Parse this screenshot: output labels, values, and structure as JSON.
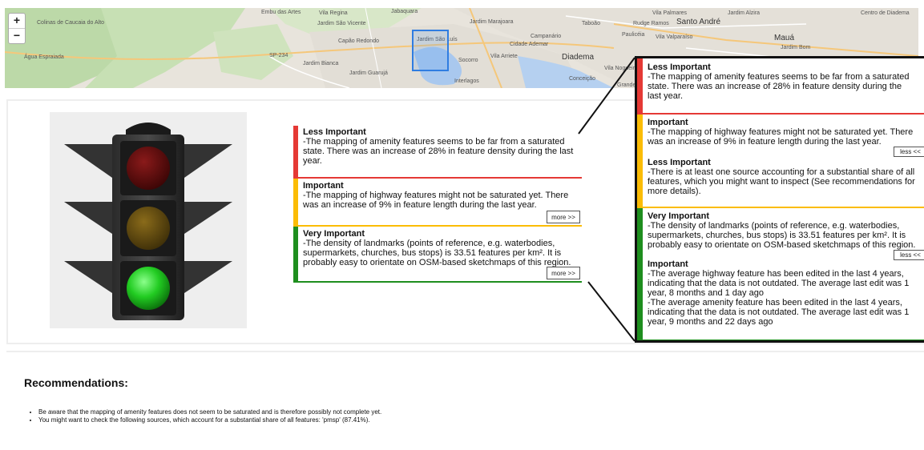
{
  "map": {
    "zoom_in": "+",
    "zoom_out": "−",
    "places": [
      "Embu das Artes",
      "Vila Regina",
      "Jardim São Vicente",
      "Jabaquara",
      "Jardim Marajoara",
      "Taboão",
      "Santo André",
      "Jardim Alzira",
      "Vila Palmares",
      "Centro de Diadema",
      "Colinas de Caucaia do Alto",
      "Cidade Ademar",
      "Diadema",
      "Campanário",
      "Jardim São Luís",
      "Socorro",
      "Vila Arriete",
      "Capão Redondo",
      "Interlagos",
      "Jardim Bianca",
      "Jardim Guarujá",
      "Conceição",
      "Vila Nogueira",
      "Mauá",
      "Jardim Bom",
      "Vila Valparaíso",
      "Paulicéia",
      "Rudge Ramos",
      "Água Espraiada",
      "Grande",
      "SP-234"
    ]
  },
  "summary": {
    "items": [
      {
        "level": "Less Important",
        "text": "-The mapping of amenity features seems to be far from a saturated state. There was an increase of 28% in feature density during the last year.",
        "color": "#e53935"
      },
      {
        "level": "Important",
        "text": "-The mapping of highway features might not be saturated yet. There was an increase of 9% in feature length during the last year.",
        "color": "#fbbc05",
        "button": "more >>"
      },
      {
        "level": "Very Important",
        "text": "-The density of landmarks (points of reference, e.g. waterbodies, supermarkets, churches, bus stops) is 33.51 features per km². It is probably easy to orientate on OSM-based sketchmaps of this region.",
        "color": "#1e8e1e",
        "button": "more >>"
      }
    ]
  },
  "popup": {
    "red": {
      "level": "Less Important",
      "text": "-The mapping of amenity features seems to be far from a saturated state. There was an increase of 28% in feature density during the last year.",
      "color": "#e53935"
    },
    "yellow": {
      "a_level": "Important",
      "a_text": "-The mapping of highway features might not be saturated yet. There was an increase of 9% in feature length during the last year.",
      "button": "less <<",
      "b_level": "Less Important",
      "b_text": "-There is at least one source accounting for a substantial share of all features, which you might want to inspect (See recommendations for more details).",
      "color": "#fbbc05"
    },
    "green": {
      "a_level": "Very Important",
      "a_text": "-The density of landmarks (points of reference, e.g. waterbodies, supermarkets, churches, bus stops) is 33.51 features per km². It is probably easy to orientate on OSM-based sketchmaps of this region.",
      "button": "less <<",
      "b_level": "Important",
      "b_text1": "-The average highway feature has been edited in the last 4 years, indicating that the data is not outdated. The average last edit was 1 year, 8 months and 1 day ago",
      "b_text2": "-The average amenity feature has been edited in the last 4 years, indicating that the data is not outdated. The average last edit was 1 year, 9 months and 22 days ago",
      "color": "#1e8e1e"
    }
  },
  "recommendations": {
    "title": "Recommendations:",
    "items": [
      "Be aware that the mapping of amenity features does not seem to be saturated and is therefore possibly not complete yet.",
      "You might want to check the following sources, which account for a substantial share of all features: 'pmsp' (87.41%)."
    ]
  },
  "traffic_light": {
    "active": "green",
    "colors": {
      "red_off": "#6a0a0a",
      "yellow_off": "#6b5410",
      "green_on": "#22cc22"
    }
  }
}
